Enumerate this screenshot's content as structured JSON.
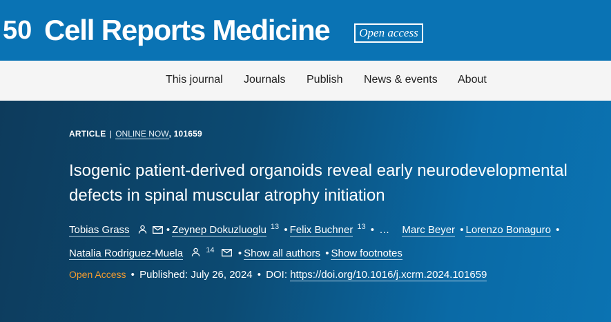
{
  "header": {
    "logo_text": "50",
    "journal_name": "Cell Reports Medicine",
    "open_access_badge": "Open access"
  },
  "nav": {
    "items": [
      "This journal",
      "Journals",
      "Publish",
      "News & events",
      "About"
    ]
  },
  "article": {
    "type_label": "ARTICLE",
    "separator": "|",
    "status_link": "ONLINE NOW",
    "article_number": ", 101659",
    "title": "Isogenic patient-derived organoids reveal early neurodevelopmental defects in spinal muscular atrophy initiation",
    "authors": [
      {
        "name": "Tobias Grass"
      },
      {
        "name": "Zeynep Dokuzluoglu",
        "sup": "13"
      },
      {
        "name": "Felix Buchner",
        "sup": "13"
      },
      {
        "name": "Marc Beyer"
      },
      {
        "name": "Lorenzo Bonaguro"
      },
      {
        "name": "Natalia Rodriguez-Muela",
        "sup": "14"
      }
    ],
    "ellipsis": "…",
    "show_all_authors": "Show all authors",
    "show_footnotes": "Show footnotes",
    "access": "Open Access",
    "published": "Published: July 26, 2024",
    "doi_label": "DOI:",
    "doi_link": "https://doi.org/10.1016/j.xcrm.2024.101659"
  }
}
